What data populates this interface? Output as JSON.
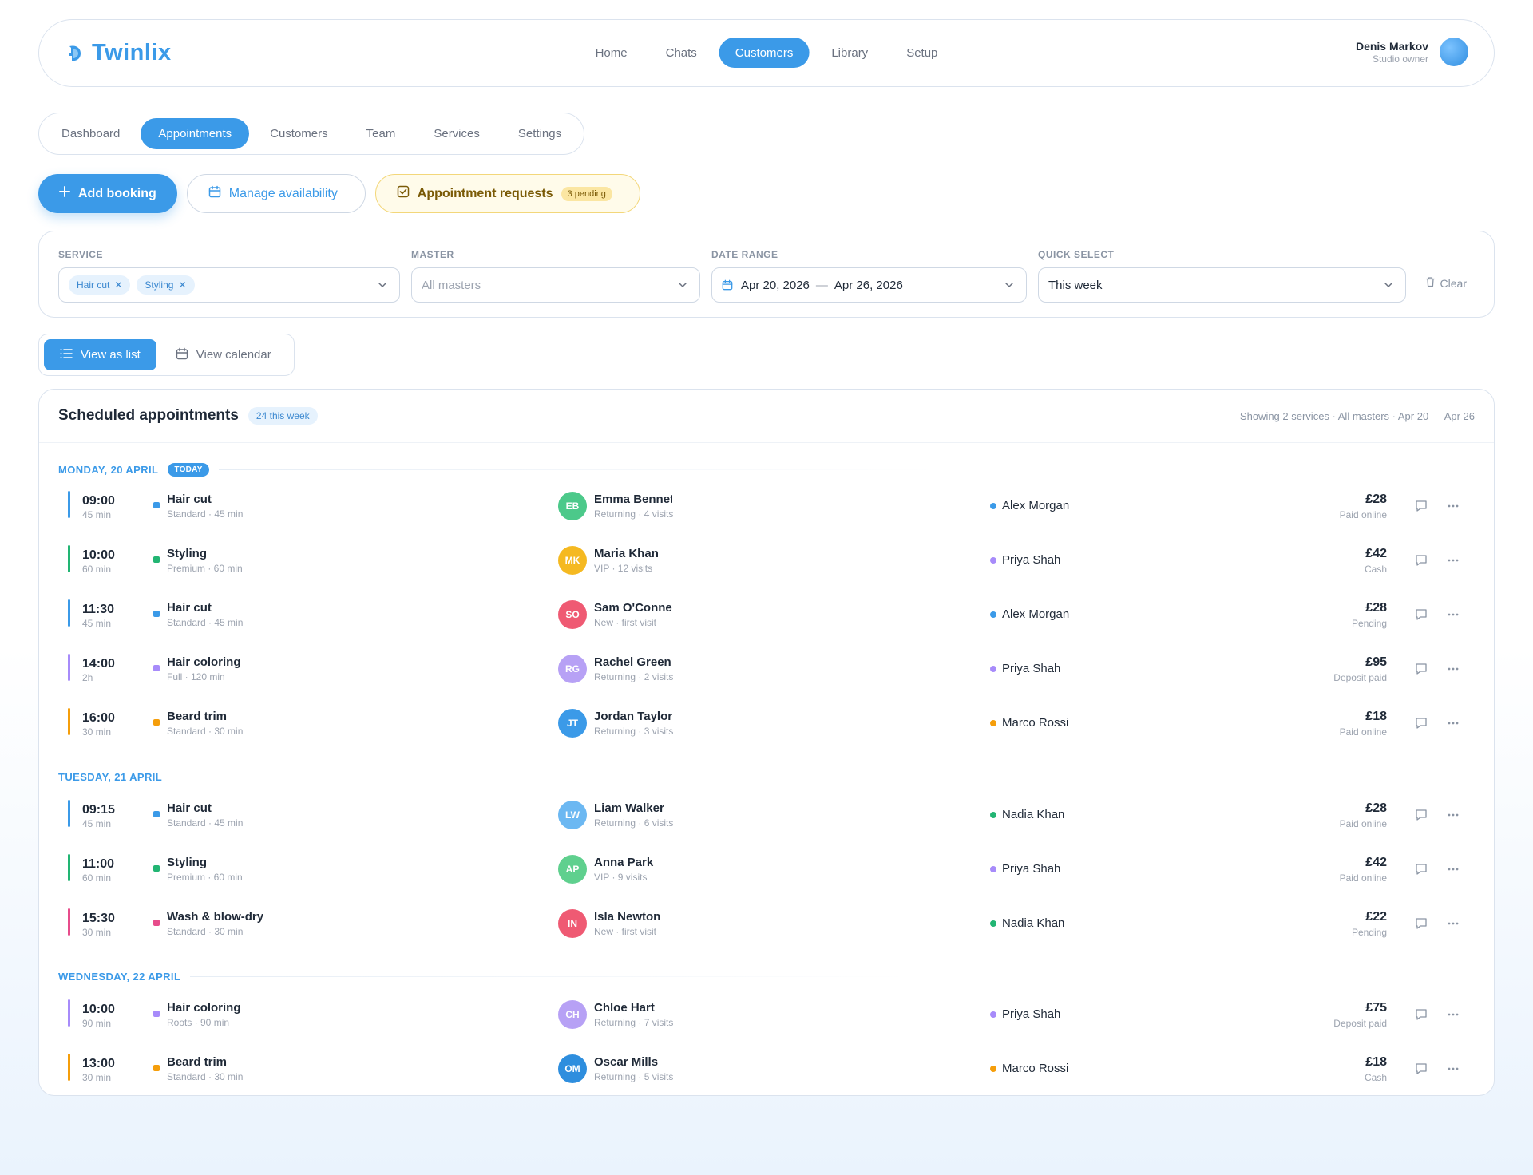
{
  "app": {
    "name": "Twinlix"
  },
  "nav": {
    "items": [
      {
        "label": "Home",
        "active": false
      },
      {
        "label": "Chats",
        "active": false
      },
      {
        "label": "Customers",
        "active": true
      },
      {
        "label": "Library",
        "active": false
      },
      {
        "label": "Setup",
        "active": false
      }
    ]
  },
  "user": {
    "name": "Denis Markov",
    "role": "Studio owner"
  },
  "subtabs": [
    {
      "label": "Dashboard",
      "active": false
    },
    {
      "label": "Appointments",
      "active": true
    },
    {
      "label": "Customers",
      "active": false
    },
    {
      "label": "Team",
      "active": false
    },
    {
      "label": "Services",
      "active": false
    },
    {
      "label": "Settings",
      "active": false
    }
  ],
  "actions": {
    "add_booking": "Add booking",
    "manage_availability": "Manage availability",
    "requests": "Appointment requests",
    "requests_badge": "3 pending"
  },
  "filters": {
    "service_label": "SERVICE",
    "service_chips": [
      "Hair cut",
      "Styling"
    ],
    "master_label": "MASTER",
    "master_placeholder": "All masters",
    "date_label": "DATE RANGE",
    "date_from": "Apr 20, 2026",
    "date_sep": "—",
    "date_to": "Apr 26, 2026",
    "quick_label": "QUICK SELECT",
    "quick_value": "This week",
    "clear_label": "Clear"
  },
  "view": {
    "list": "View as list",
    "calendar": "View calendar",
    "active": "list"
  },
  "panel": {
    "title": "Scheduled appointments",
    "badge": "24 this week",
    "meta": "Showing 2 services · All masters · Apr 20 — Apr 26"
  },
  "colors": {
    "accent": "#3b9ae8",
    "haircut": "#3b9ae8",
    "styling": "#22b573",
    "coloring": "#a78bfa",
    "beard": "#f59e0b",
    "wash": "#e74c8b"
  },
  "days": [
    {
      "label": "MONDAY, 20 APRIL",
      "today_badge": "TODAY",
      "rows": [
        {
          "time": "09:00",
          "dur": "45 min",
          "color": "#3b9ae8",
          "service": "Hair cut",
          "service_sub": "Standard · 45 min",
          "initials": "EB",
          "av_color": "#4cc98a",
          "customer": "Emma Bennett",
          "customer_sub": "Returning · 4 visits",
          "master_color": "#3b9ae8",
          "master": "Alex Morgan",
          "price": "£28",
          "status": "Paid online"
        },
        {
          "time": "10:00",
          "dur": "60 min",
          "color": "#22b573",
          "service": "Styling",
          "service_sub": "Premium · 60 min",
          "initials": "MK",
          "av_color": "#f5b921",
          "customer": "Maria Khan",
          "customer_sub": "VIP · 12 visits",
          "master_color": "#a78bfa",
          "master": "Priya Shah",
          "price": "£42",
          "status": "Cash"
        },
        {
          "time": "11:30",
          "dur": "45 min",
          "color": "#3b9ae8",
          "service": "Hair cut",
          "service_sub": "Standard · 45 min",
          "initials": "SO",
          "av_color": "#ef5a73",
          "customer": "Sam O'Connell",
          "customer_sub": "New · first visit",
          "master_color": "#3b9ae8",
          "master": "Alex Morgan",
          "price": "£28",
          "status": "Pending"
        },
        {
          "time": "14:00",
          "dur": "2h",
          "color": "#a78bfa",
          "service": "Hair coloring",
          "service_sub": "Full · 120 min",
          "initials": "RG",
          "av_color": "#b7a1f5",
          "customer": "Rachel Green",
          "customer_sub": "Returning · 2 visits",
          "master_color": "#a78bfa",
          "master": "Priya Shah",
          "price": "£95",
          "status": "Deposit paid"
        },
        {
          "time": "16:00",
          "dur": "30 min",
          "color": "#f59e0b",
          "service": "Beard trim",
          "service_sub": "Standard · 30 min",
          "initials": "JT",
          "av_color": "#3b9ae8",
          "customer": "Jordan Taylor",
          "customer_sub": "Returning · 3 visits",
          "master_color": "#f59e0b",
          "master": "Marco Rossi",
          "price": "£18",
          "status": "Paid online"
        }
      ]
    },
    {
      "label": "TUESDAY, 21 APRIL",
      "today_badge": "",
      "rows": [
        {
          "time": "09:15",
          "dur": "45 min",
          "color": "#3b9ae8",
          "service": "Hair cut",
          "service_sub": "Standard · 45 min",
          "initials": "LW",
          "av_color": "#6cb8f2",
          "customer": "Liam Walker",
          "customer_sub": "Returning · 6 visits",
          "master_color": "#22b573",
          "master": "Nadia Khan",
          "price": "£28",
          "status": "Paid online"
        },
        {
          "time": "11:00",
          "dur": "60 min",
          "color": "#22b573",
          "service": "Styling",
          "service_sub": "Premium · 60 min",
          "initials": "AP",
          "av_color": "#5fd08e",
          "customer": "Anna Park",
          "customer_sub": "VIP · 9 visits",
          "master_color": "#a78bfa",
          "master": "Priya Shah",
          "price": "£42",
          "status": "Paid online"
        },
        {
          "time": "15:30",
          "dur": "30 min",
          "color": "#e74c8b",
          "service": "Wash & blow-dry",
          "service_sub": "Standard · 30 min",
          "initials": "IN",
          "av_color": "#ef5a73",
          "customer": "Isla Newton",
          "customer_sub": "New · first visit",
          "master_color": "#22b573",
          "master": "Nadia Khan",
          "price": "£22",
          "status": "Pending"
        }
      ]
    },
    {
      "label": "WEDNESDAY, 22 APRIL",
      "today_badge": "",
      "rows": [
        {
          "time": "10:00",
          "dur": "90 min",
          "color": "#a78bfa",
          "service": "Hair coloring",
          "service_sub": "Roots · 90 min",
          "initials": "CH",
          "av_color": "#b7a1f5",
          "customer": "Chloe Hart",
          "customer_sub": "Returning · 7 visits",
          "master_color": "#a78bfa",
          "master": "Priya Shah",
          "price": "£75",
          "status": "Deposit paid"
        },
        {
          "time": "13:00",
          "dur": "30 min",
          "color": "#f59e0b",
          "service": "Beard trim",
          "service_sub": "Standard · 30 min",
          "initials": "OM",
          "av_color": "#2e8ede",
          "customer": "Oscar Mills",
          "customer_sub": "Returning · 5 visits",
          "master_color": "#f59e0b",
          "master": "Marco Rossi",
          "price": "£18",
          "status": "Cash"
        }
      ]
    }
  ]
}
